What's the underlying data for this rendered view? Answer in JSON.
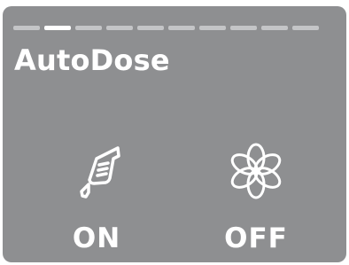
{
  "screen": {
    "background_color": "#8e8f91",
    "progress": {
      "total_steps": 10,
      "current_step": 2
    },
    "title": "AutoDose",
    "options": [
      {
        "icon": "dose-cup-icon",
        "label": "ON"
      },
      {
        "icon": "flower-icon",
        "label": "OFF"
      }
    ]
  }
}
